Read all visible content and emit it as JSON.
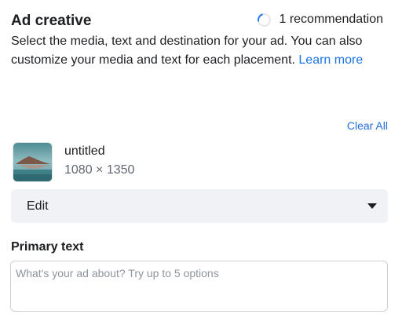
{
  "header": {
    "title": "Ad creative",
    "recommendation": "1 recommendation"
  },
  "description": {
    "text": "Select the media, text and destination for your ad. You can also customize your media and text for each placement. ",
    "link": "Learn more"
  },
  "actions": {
    "clear_all": "Clear All"
  },
  "media": {
    "name": "untitled",
    "dimensions": "1080 × 1350"
  },
  "edit_select": {
    "label": "Edit"
  },
  "primary_text": {
    "label": "Primary text",
    "value": "",
    "placeholder": "What's your ad about? Try up to 5 options"
  },
  "colors": {
    "link": "#1b74e4",
    "select_bg": "#f0f2f5",
    "border": "#ccd0d5"
  },
  "icons": [
    "loading-spinner-icon",
    "media-thumbnail",
    "caret-down-icon"
  ]
}
